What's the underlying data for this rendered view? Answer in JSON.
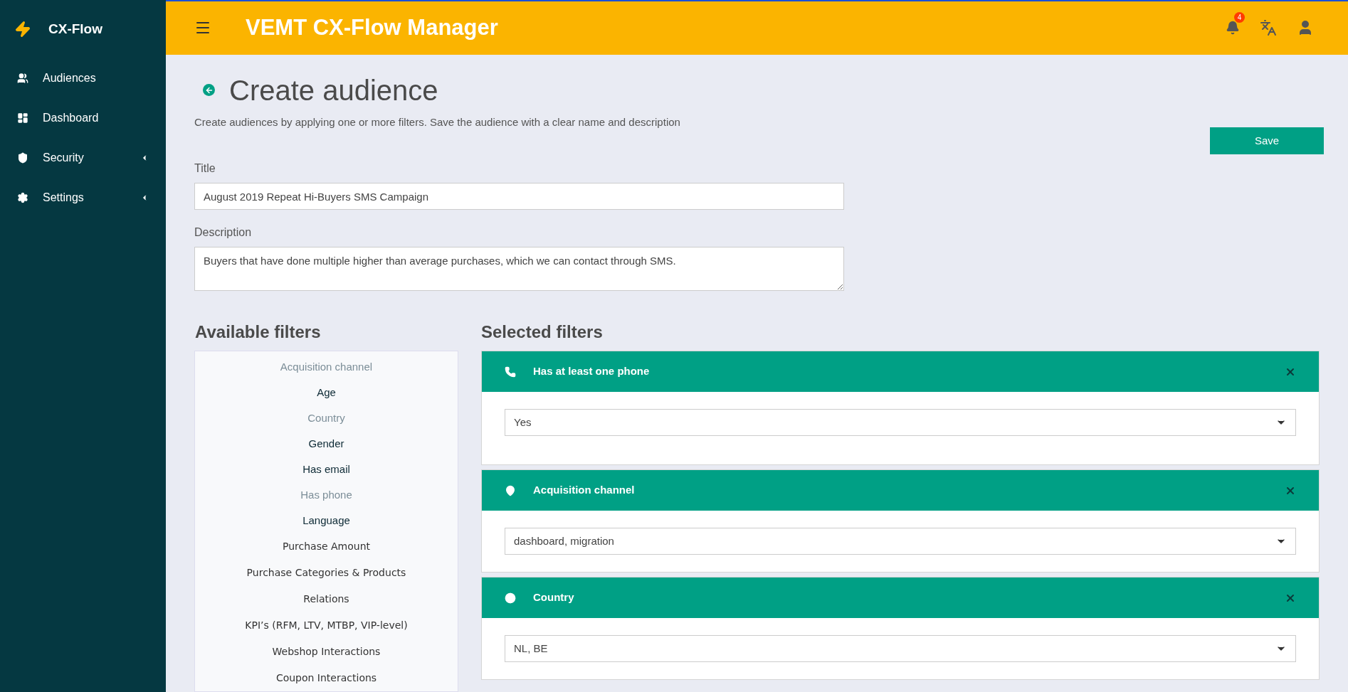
{
  "sidebar": {
    "brand": "CX-Flow",
    "items": [
      {
        "label": "Audiences",
        "has_submenu": false
      },
      {
        "label": "Dashboard",
        "has_submenu": false
      },
      {
        "label": "Security",
        "has_submenu": true
      },
      {
        "label": "Settings",
        "has_submenu": true
      }
    ]
  },
  "header": {
    "title": "VEMT CX-Flow Manager",
    "notification_count": "4"
  },
  "page": {
    "title": "Create audience",
    "subtitle": "Create audiences by applying one or more filters. Save the audience with a clear name and description",
    "save_button": "Save"
  },
  "form": {
    "title_label": "Title",
    "title_value": "August 2019 Repeat Hi-Buyers SMS Campaign",
    "description_label": "Description",
    "description_value": "Buyers that have done multiple higher than average purchases, which we can contact through SMS."
  },
  "available_filters": {
    "heading": "Available filters",
    "items": [
      {
        "label": "Acquisition channel",
        "disabled": true,
        "kind": "profile"
      },
      {
        "label": "Age",
        "disabled": false,
        "kind": "profile"
      },
      {
        "label": "Country",
        "disabled": true,
        "kind": "profile"
      },
      {
        "label": "Gender",
        "disabled": false,
        "kind": "profile"
      },
      {
        "label": "Has email",
        "disabled": false,
        "kind": "profile"
      },
      {
        "label": "Has phone",
        "disabled": true,
        "kind": "profile"
      },
      {
        "label": "Language",
        "disabled": false,
        "kind": "profile"
      },
      {
        "label": "Purchase Amount",
        "disabled": false,
        "kind": "behaviour"
      },
      {
        "label": "Purchase Categories & Products",
        "disabled": false,
        "kind": "behaviour"
      },
      {
        "label": "Relations",
        "disabled": false,
        "kind": "behaviour"
      },
      {
        "label": "KPI’s (RFM, LTV, MTBP, VIP-level)",
        "disabled": false,
        "kind": "behaviour"
      },
      {
        "label": "Webshop Interactions",
        "disabled": false,
        "kind": "behaviour"
      },
      {
        "label": "Coupon Interactions",
        "disabled": false,
        "kind": "behaviour"
      }
    ]
  },
  "selected_filters": {
    "heading": "Selected filters",
    "items": [
      {
        "title": "Has at least one phone",
        "value": "Yes"
      },
      {
        "title": "Acquisition channel",
        "value": "dashboard, migration"
      },
      {
        "title": "Country",
        "value": "NL, BE"
      }
    ]
  }
}
